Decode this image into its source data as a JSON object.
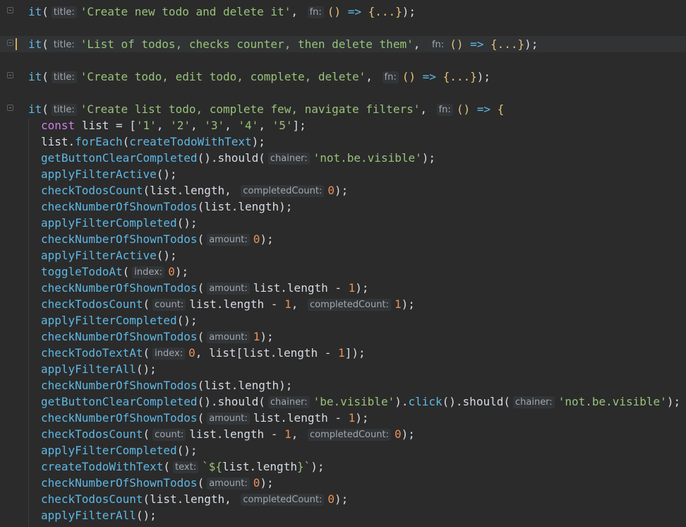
{
  "editor": {
    "hints": {
      "title": "title:",
      "fn": "fn:",
      "chainer": "chainer:",
      "completedCount": "completedCount:",
      "amount": "amount:",
      "index": "index:",
      "count": "count:",
      "text": "text:"
    },
    "tests": [
      "'Create new todo and delete it'",
      "'List of todos, checks counter, then delete them'",
      "'Create todo, edit todo, complete, delete'",
      "'Create list todo, complete few, navigate filters'"
    ],
    "strings": {
      "one": "'1'",
      "two": "'2'",
      "three": "'3'",
      "four": "'4'",
      "five": "'5'",
      "not_be_visible": "'not.be.visible'",
      "be_visible": "'be.visible'",
      "template_open": "`${",
      "template_close": "}`"
    },
    "names": {
      "it": "it",
      "const": "const",
      "list": "list",
      "forEach": "forEach",
      "createTodoWithText": "createTodoWithText",
      "getButtonClearCompleted": "getButtonClearCompleted",
      "should": "should",
      "click": "click",
      "length": "length",
      "applyFilterActive": "applyFilterActive",
      "applyFilterCompleted": "applyFilterCompleted",
      "applyFilterAll": "applyFilterAll",
      "checkTodosCount": "checkTodosCount",
      "checkNumberOfShownTodos": "checkNumberOfShownTodos",
      "toggleTodoAt": "toggleTodoAt",
      "checkTodoTextAt": "checkTodoTextAt"
    },
    "numbers": {
      "zero": "0",
      "one": "1"
    },
    "tokens": {
      "arrow": "=>",
      "collapsed": "{...}"
    }
  }
}
